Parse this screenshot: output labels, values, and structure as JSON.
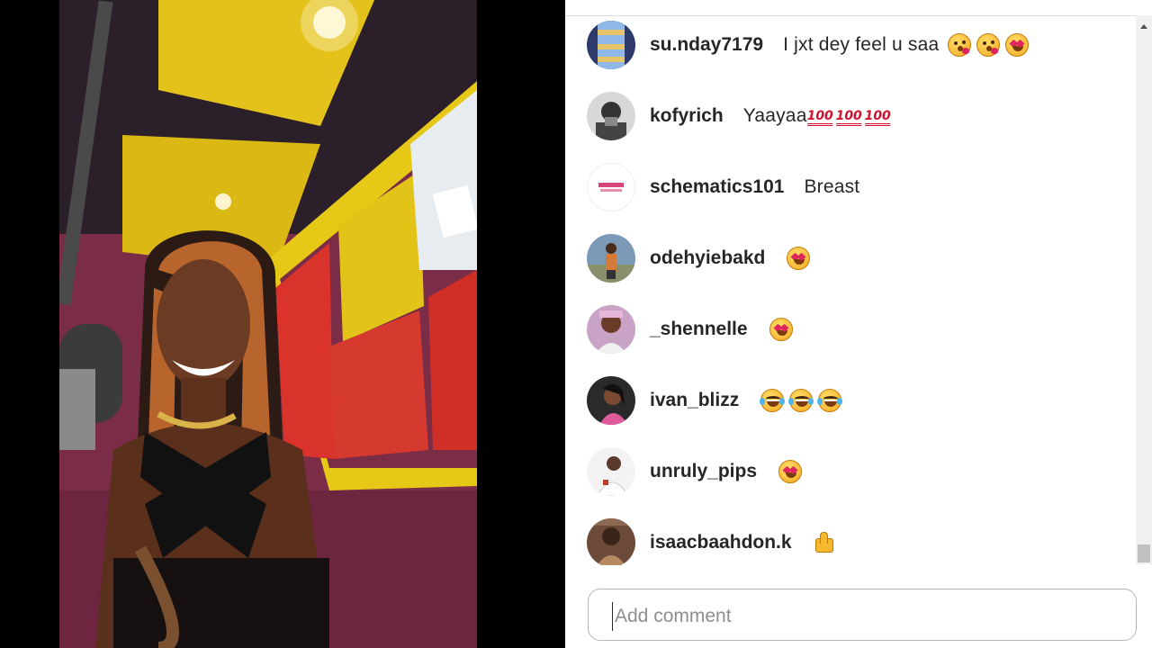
{
  "comments": [
    {
      "username": "su.nday7179",
      "text": "I jxt dey feel u saa",
      "emojis": [
        "kiss",
        "kiss",
        "heart-eyes"
      ],
      "avatar": "blue-striped"
    },
    {
      "username": "kofyrich",
      "text": "Yaayaa",
      "emojis": [
        "hundred",
        "hundred",
        "hundred"
      ],
      "avatar": "grey-portrait"
    },
    {
      "username": "schematics101",
      "text": "Breast",
      "emojis": [],
      "avatar": "white-logo"
    },
    {
      "username": "odehyiebakd",
      "text": "",
      "emojis": [
        "heart-eyes"
      ],
      "avatar": "outdoor-portrait"
    },
    {
      "username": "_shennelle",
      "text": "",
      "emojis": [
        "heart-eyes"
      ],
      "avatar": "pink-portrait"
    },
    {
      "username": "ivan_blizz",
      "text": "",
      "emojis": [
        "laugh",
        "laugh",
        "laugh"
      ],
      "avatar": "dark-portrait"
    },
    {
      "username": "unruly_pips",
      "text": "",
      "emojis": [
        "heart-eyes"
      ],
      "avatar": "white-portrait"
    },
    {
      "username": "isaacbaahdon.k",
      "text": "",
      "emojis": [
        "thumbs-up"
      ],
      "avatar": "brown-portrait"
    }
  ],
  "comment_input": {
    "placeholder": "Add comment",
    "value": ""
  },
  "colors": {
    "panel_bg": "#ffffff",
    "text": "#262626",
    "placeholder": "#8e8e8e",
    "video_letterbox": "#000000"
  }
}
